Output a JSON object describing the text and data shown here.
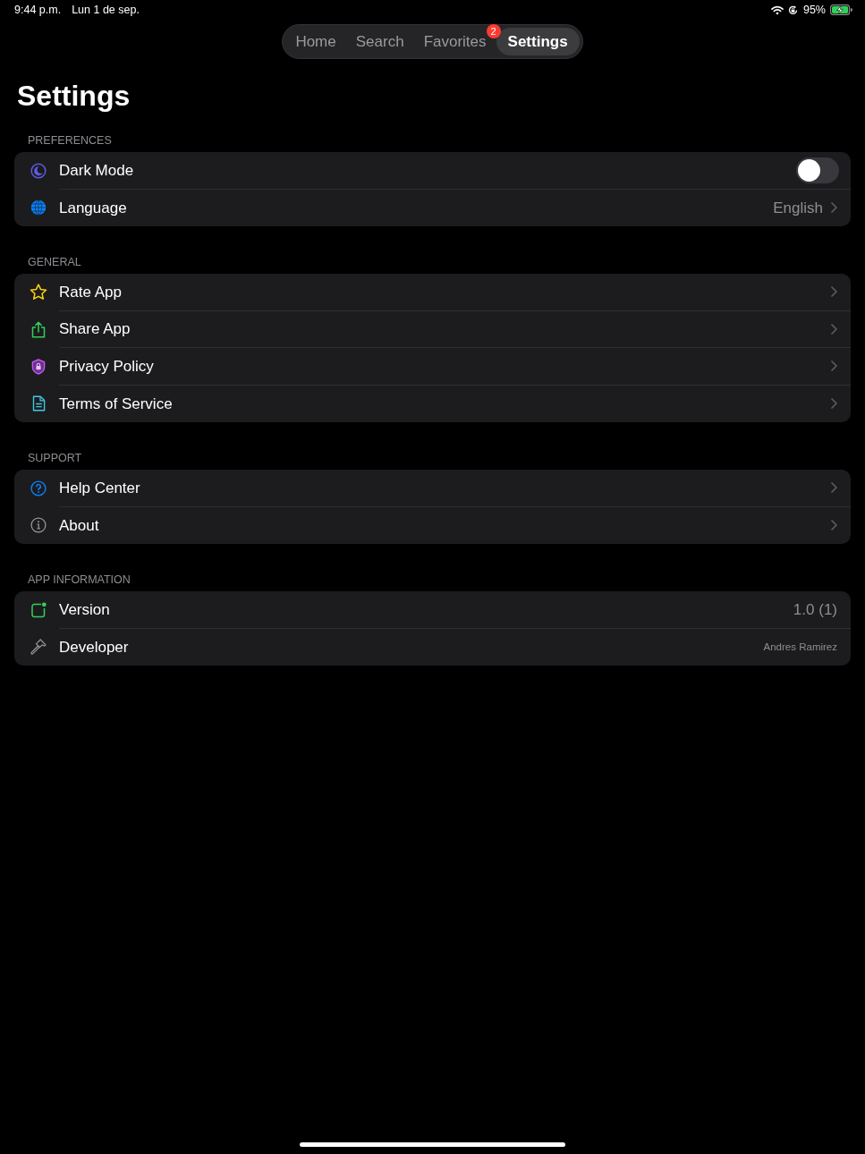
{
  "status_bar": {
    "time": "9:44 p.m.",
    "date": "Lun 1 de sep.",
    "battery": "95%"
  },
  "tabs": [
    {
      "label": "Home",
      "selected": false
    },
    {
      "label": "Search",
      "selected": false
    },
    {
      "label": "Favorites",
      "selected": false,
      "badge": "2"
    },
    {
      "label": "Settings",
      "selected": true
    }
  ],
  "title": "Settings",
  "sections": [
    {
      "header": "PREFERENCES",
      "rows": [
        {
          "kind": "toggle",
          "label": "Dark Mode",
          "on": false
        },
        {
          "kind": "link",
          "label": "Language",
          "value": "English"
        }
      ]
    },
    {
      "header": "GENERAL",
      "rows": [
        {
          "kind": "link",
          "label": "Rate App"
        },
        {
          "kind": "link",
          "label": "Share App"
        },
        {
          "kind": "link",
          "label": "Privacy Policy"
        },
        {
          "kind": "link",
          "label": "Terms of Service"
        }
      ]
    },
    {
      "header": "SUPPORT",
      "rows": [
        {
          "kind": "link",
          "label": "Help Center"
        },
        {
          "kind": "link",
          "label": "About"
        }
      ]
    },
    {
      "header": "APP INFORMATION",
      "rows": [
        {
          "kind": "value",
          "label": "Version",
          "value": "1.0 (1)"
        },
        {
          "kind": "note",
          "label": "Developer",
          "value": "Andres Ramirez"
        }
      ]
    }
  ]
}
